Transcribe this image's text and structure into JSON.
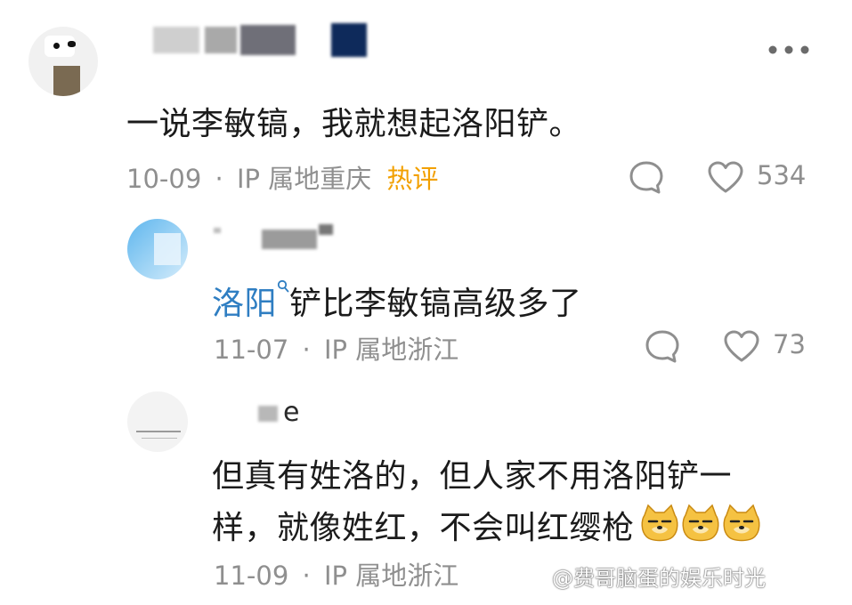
{
  "comments": [
    {
      "text": "一说李敏镐，我就想起洛阳铲。",
      "date": "10-09",
      "dot": "·",
      "ip": "IP 属地重庆",
      "tag": "热评",
      "likes": "534"
    },
    {
      "link_text": "洛阳",
      "text": "铲比李敏镐高级多了",
      "date": "11-07",
      "dot": "·",
      "ip": "IP 属地浙江",
      "likes": "73"
    },
    {
      "username_partial": "e",
      "text_line1": "但真有姓洛的，但人家不用洛阳铲一",
      "text_line2": "样，就像姓红，不会叫红缨枪",
      "date": "11-09",
      "dot": "·",
      "ip": "IP 属地浙江"
    }
  ],
  "more_icon": "ellipsis-icon",
  "watermark": "@费哥脑蛋的娱乐时光",
  "colors": {
    "hot": "#f2a000",
    "link": "#2f7ec2",
    "meta": "#8f8f8f"
  }
}
